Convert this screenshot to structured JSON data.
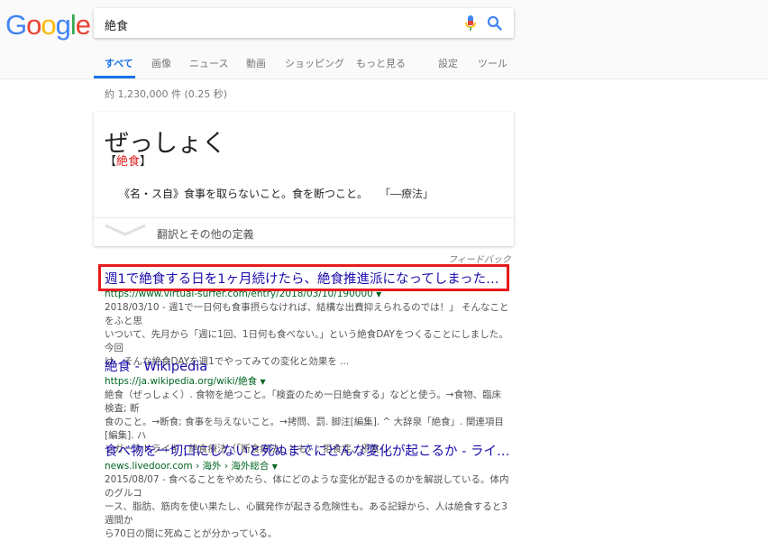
{
  "search": {
    "query": "絶食"
  },
  "tabs": [
    {
      "label": "すべて"
    },
    {
      "label": "画像"
    },
    {
      "label": "ニュース"
    },
    {
      "label": "動画"
    },
    {
      "label": "ショッピング"
    },
    {
      "label": "もっと見る"
    },
    {
      "label": "設定"
    },
    {
      "label": "ツール"
    }
  ],
  "stats": "約 1,230,000 件  (0.25 秒)",
  "dictionary": {
    "reading": "ぜっしょく",
    "kanji_open": "【",
    "kanji": "絶食",
    "kanji_close": "】",
    "definition": "《名・ス自》食事を取らないこと。食を断つこと。",
    "example": "「―療法」",
    "more": "翻訳とその他の定義"
  },
  "feedback": "フィードバック",
  "results": [
    {
      "title": "週1で絶食する日を1ヶ月続けたら、絶食推進派になってしまった話 - 仮...",
      "url": "https://www.virtual-surfer.com/entry/2018/03/10/190000",
      "snippet_lines": [
        "2018/03/10 - 週1で一日何も食事摂らなければ、結構な出費抑えられるのでは！」 そんなことをふと思",
        "いついて、先月から「週に1回、1日何も食べない。」という絶食DAYをつくることにしました。今回",
        "は、そんな絶食DAYを週1でやってみての変化と効果を ..."
      ]
    },
    {
      "title": "絶食 - Wikipedia",
      "url": "https://ja.wikipedia.org/wiki/絶食",
      "snippet_lines": [
        "絶食（ぜっしょく）. 食物を絶つこと。「検査のため一日絶食する」などと使う。→食物、臨床検査; 断",
        "食のこと。→断食; 食事を与えないこと。→拷問、罰. 脚注[編集]. ^ 大辞泉「絶食」. 関連項目[編集]. ハ",
        "ンガーストライキ · 絶食療法（「断食療法」とも）; 拒食症、摂食 ..."
      ]
    },
    {
      "title": "食べ物を一切口にしないと死ぬまでにどんな変化が起こるか - ライブド...",
      "url": "news.livedoor.com › 海外 › 海外総合",
      "snippet_lines": [
        "2015/08/07 - 食べることをやめたら、体にどのような変化が起きるのかを解説している。体内のグルコ",
        "ース、脂肪、筋肉を使い果たし、心臓発作が起きる危険性も。ある記録から、人は絶食すると3週間か",
        "ら70日の間に死ぬことが分かっている。"
      ]
    }
  ],
  "colors": {
    "link": "#1a0dab",
    "url": "#006621",
    "accent": "#1a73e8",
    "annotation": "#e8191c"
  }
}
